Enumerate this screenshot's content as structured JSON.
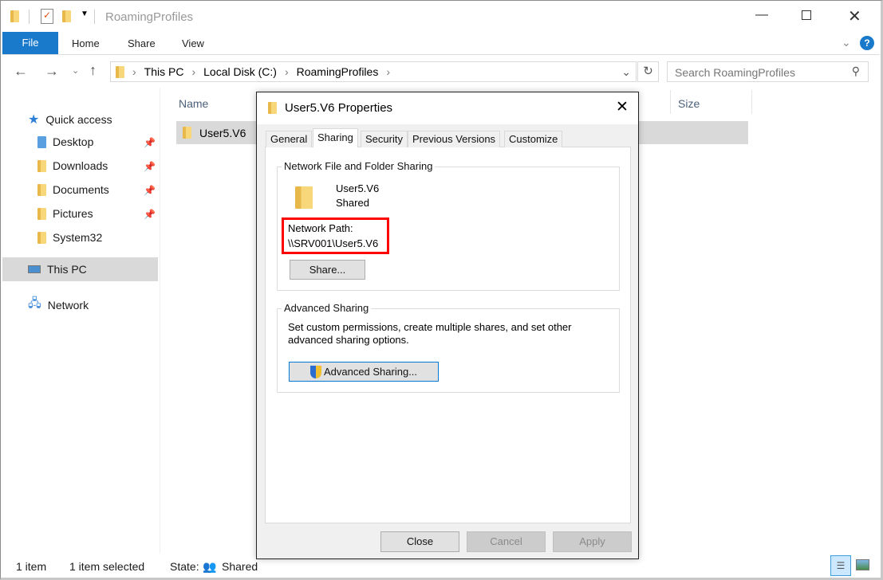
{
  "window": {
    "title": "RoamingProfiles"
  },
  "ribbon": {
    "tabs": [
      "File",
      "Home",
      "Share",
      "View"
    ]
  },
  "address": {
    "crumbs": [
      "This PC",
      "Local Disk (C:)",
      "RoamingProfiles"
    ],
    "search_placeholder": "Search RoamingProfiles"
  },
  "sidebar": {
    "items": [
      {
        "label": "Quick access",
        "icon": "star-icon"
      },
      {
        "label": "Desktop",
        "icon": "folder-icon",
        "pinned": true
      },
      {
        "label": "Downloads",
        "icon": "download-folder-icon",
        "pinned": true
      },
      {
        "label": "Documents",
        "icon": "documents-icon",
        "pinned": true
      },
      {
        "label": "Pictures",
        "icon": "pictures-icon",
        "pinned": true
      },
      {
        "label": "System32",
        "icon": "folder-icon"
      },
      {
        "label": "This PC",
        "icon": "computer-icon",
        "selected": true
      },
      {
        "label": "Network",
        "icon": "network-icon"
      }
    ]
  },
  "filelist": {
    "columns": [
      "Name",
      "Size"
    ],
    "rows": [
      {
        "name": "User5.V6",
        "selected": true
      }
    ]
  },
  "dialog": {
    "title": "User5.V6 Properties",
    "tabs": [
      "General",
      "Sharing",
      "Security",
      "Previous Versions",
      "Customize"
    ],
    "active_tab": "Sharing",
    "network_group": {
      "label": "Network File and Folder Sharing",
      "name": "User5.V6",
      "status": "Shared",
      "path_label": "Network Path:",
      "path": "\\\\SRV001\\User5.V6",
      "share_button": "Share..."
    },
    "advanced_group": {
      "label": "Advanced Sharing",
      "description_line1": "Set custom permissions, create multiple shares, and set other",
      "description_line2": "advanced sharing options.",
      "button": "Advanced Sharing..."
    },
    "buttons": {
      "close": "Close",
      "cancel": "Cancel",
      "apply": "Apply"
    }
  },
  "statusbar": {
    "count": "1 item",
    "selected": "1 item selected",
    "state_label": "State:",
    "state_value": "Shared"
  },
  "colors": {
    "accent": "#1979ca",
    "highlight": "#ff0000",
    "selection": "#d9d9d9"
  }
}
